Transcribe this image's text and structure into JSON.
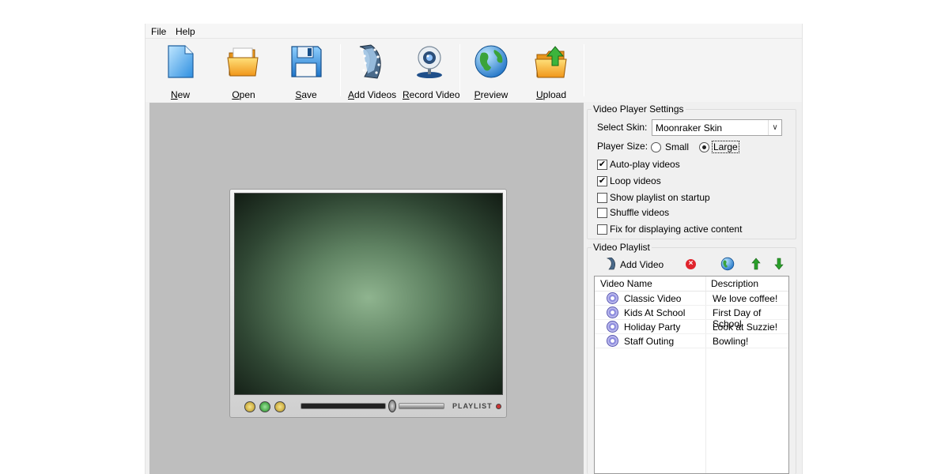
{
  "menu": {
    "file": "File",
    "help": "Help"
  },
  "toolbar": {
    "new": {
      "label_first": "N",
      "label_rest": "ew"
    },
    "open": {
      "label_first": "O",
      "label_rest": "pen"
    },
    "save": {
      "label_first": "S",
      "label_rest": "ave"
    },
    "add_videos": {
      "label_first": "A",
      "label_rest": "dd Videos"
    },
    "record_video": {
      "label_first": "R",
      "label_rest": "ecord Video"
    },
    "preview": {
      "label_first": "P",
      "label_rest": "review"
    },
    "upload": {
      "label_first": "U",
      "label_rest": "pload"
    }
  },
  "player": {
    "playlist_label": "PLAYLIST"
  },
  "settings": {
    "group_title": "Video Player Settings",
    "skin_label": "Select Skin:",
    "skin_value": "Moonraker Skin",
    "size_label": "Player Size:",
    "size_small": "Small",
    "size_large": "Large",
    "size_selected": "Large",
    "options": [
      {
        "label": "Auto-play videos",
        "checked": true
      },
      {
        "label": "Loop videos",
        "checked": true
      },
      {
        "label": "Show playlist on startup",
        "checked": false
      },
      {
        "label": "Shuffle videos",
        "checked": false
      },
      {
        "label": "Fix for displaying active content",
        "checked": false
      }
    ]
  },
  "playlist": {
    "group_title": "Video Playlist",
    "add_video_label": "Add Video",
    "columns": [
      "Video Name",
      "Description"
    ],
    "rows": [
      {
        "name": "Classic Video",
        "description": "We love coffee!"
      },
      {
        "name": "Kids At School",
        "description": "First Day of School"
      },
      {
        "name": "Holiday Party",
        "description": "Look at Suzzie!"
      },
      {
        "name": "Staff Outing",
        "description": "Bowling!"
      }
    ]
  },
  "colors": {
    "preview_bg": "#bebebe",
    "window_bg": "#f0f0f0",
    "remove_red": "#e0242c",
    "arrow_green": "#2aa12a"
  }
}
